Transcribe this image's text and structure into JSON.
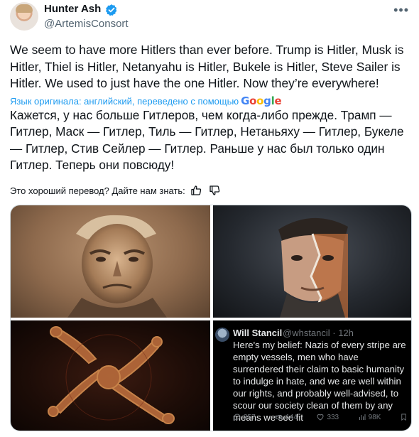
{
  "author": {
    "name": "Hunter Ash",
    "handle": "@ArtemisConsort"
  },
  "tweet": {
    "text": "We seem to have more Hitlers than ever before. Trump is Hitler, Musk is Hitler, Thiel is Hitler, Netanyahu is Hitler, Bukele is Hitler, Steve Sailer is Hitler. We used to just have the one Hitler. Now they’re everywhere!",
    "translation_note": "Язык оригинала: английский, переведено с помощью",
    "translation_provider": "Google",
    "translated_text": "Кажется, у нас больше Гитлеров, чем когда-либо прежде. Трамп — Гитлер, Маск — Гитлер, Тиль — Гитлер, Нетаньяху — Гитлер, Букеле — Гитлер, Стив Сейлер — Гитлер. Раньше у нас был только один Гитлер. Теперь они повсюду!",
    "rate_prompt": "Это хороший перевод? Дайте нам знать:"
  },
  "media": {
    "embedded_tweet": {
      "name": "Will Stancil",
      "handle_time": "@whstancil · 12h",
      "text": "Here's my belief: Nazis of every stripe are empty vessels, men who have surrendered their claim to basic humanity to indulge in hate, and we are well within our rights, and probably well-advised, to scour our society clean of them by any means we see fit",
      "replies": "357",
      "retweets": "144",
      "likes": "333",
      "views": "98K"
    }
  },
  "colors": {
    "accent": "#1d9bf0",
    "text": "#0f1419",
    "secondary": "#536471"
  }
}
